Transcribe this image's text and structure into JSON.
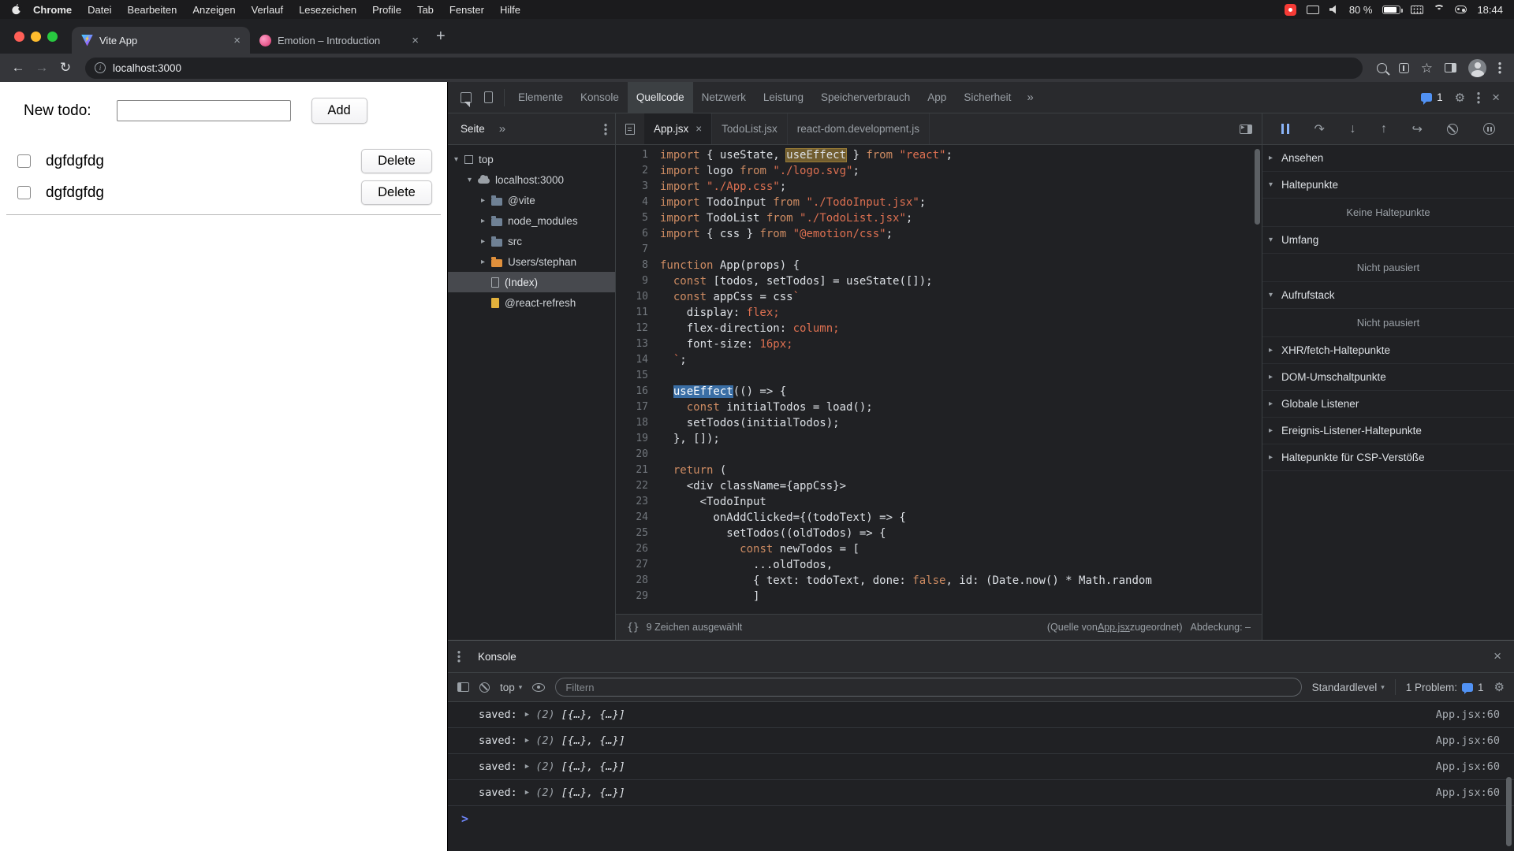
{
  "menubar": {
    "items": [
      "Chrome",
      "Datei",
      "Bearbeiten",
      "Anzeigen",
      "Verlauf",
      "Lesezeichen",
      "Profile",
      "Tab",
      "Fenster",
      "Hilfe"
    ],
    "battery": "80 %",
    "time": "18:44"
  },
  "browser": {
    "tabs": [
      {
        "title": "Vite App",
        "icon": "vite"
      },
      {
        "title": "Emotion – Introduction",
        "icon": "emotion"
      }
    ],
    "url": "localhost:3000",
    "new_tab": "+"
  },
  "page": {
    "new_todo_label": "New todo:",
    "add_button": "Add",
    "delete_button": "Delete",
    "todos": [
      "dgfdgfdg",
      "dgfdgfdg"
    ]
  },
  "devtools": {
    "top_tabs": [
      {
        "label": "Elemente",
        "selected": false
      },
      {
        "label": "Konsole",
        "selected": false
      },
      {
        "label": "Quellcode",
        "selected": true
      },
      {
        "label": "Netzwerk",
        "selected": false
      },
      {
        "label": "Leistung",
        "selected": false
      },
      {
        "label": "Speicherverbrauch",
        "selected": false
      },
      {
        "label": "App",
        "selected": false
      },
      {
        "label": "Sicherheit",
        "selected": false
      }
    ],
    "more_tabs": "»",
    "issues_count": "1",
    "navigator": {
      "tab": "Seite",
      "more": "»",
      "tree": [
        {
          "label": "top",
          "depth": 0,
          "caret": "expanded",
          "icon": "frame",
          "selected": false
        },
        {
          "label": "localhost:3000",
          "depth": 1,
          "caret": "expanded",
          "icon": "cloud",
          "selected": false
        },
        {
          "label": "@vite",
          "depth": 2,
          "caret": "collapsed",
          "icon": "folder",
          "selected": false
        },
        {
          "label": "node_modules",
          "depth": 2,
          "caret": "collapsed",
          "icon": "folder",
          "selected": false
        },
        {
          "label": "src",
          "depth": 2,
          "caret": "collapsed",
          "icon": "folder",
          "selected": false
        },
        {
          "label": "Users/stephan",
          "depth": 2,
          "caret": "collapsed",
          "icon": "folder-orange",
          "selected": false
        },
        {
          "label": "(Index)",
          "depth": 2,
          "caret": "none",
          "icon": "doc",
          "selected": true
        },
        {
          "label": "@react-refresh",
          "depth": 2,
          "caret": "none",
          "icon": "doc-orange",
          "selected": false
        }
      ]
    },
    "editor": {
      "tabs": [
        {
          "label": "App.jsx",
          "selected": true,
          "closable": true
        },
        {
          "label": "TodoList.jsx",
          "selected": false,
          "closable": false
        },
        {
          "label": "react-dom.development.js",
          "selected": false,
          "closable": false
        }
      ],
      "status_left": "9 Zeichen ausgewählt",
      "status_right_pre": "(Quelle von ",
      "status_right_link": "App.jsx",
      "status_right_post": " zugeordnet)",
      "status_coverage": "Abdeckung: –",
      "code": [
        {
          "n": "1",
          "t": [
            [
              "k",
              "import"
            ],
            [
              "p",
              " { useState, "
            ],
            [
              "m",
              "useEffect"
            ],
            [
              "p",
              " } "
            ],
            [
              "k",
              "from"
            ],
            [
              "p",
              " "
            ],
            [
              "s",
              "\"react\""
            ],
            [
              "p",
              ";"
            ]
          ]
        },
        {
          "n": "2",
          "t": [
            [
              "k",
              "import"
            ],
            [
              "p",
              " logo "
            ],
            [
              "k",
              "from"
            ],
            [
              "p",
              " "
            ],
            [
              "s",
              "\"./logo.svg\""
            ],
            [
              "p",
              ";"
            ]
          ]
        },
        {
          "n": "3",
          "t": [
            [
              "k",
              "import"
            ],
            [
              "p",
              " "
            ],
            [
              "s",
              "\"./App.css\""
            ],
            [
              "p",
              ";"
            ]
          ]
        },
        {
          "n": "4",
          "t": [
            [
              "k",
              "import"
            ],
            [
              "p",
              " TodoInput "
            ],
            [
              "k",
              "from"
            ],
            [
              "p",
              " "
            ],
            [
              "s",
              "\"./TodoInput.jsx\""
            ],
            [
              "p",
              ";"
            ]
          ]
        },
        {
          "n": "5",
          "t": [
            [
              "k",
              "import"
            ],
            [
              "p",
              " TodoList "
            ],
            [
              "k",
              "from"
            ],
            [
              "p",
              " "
            ],
            [
              "s",
              "\"./TodoList.jsx\""
            ],
            [
              "p",
              ";"
            ]
          ]
        },
        {
          "n": "6",
          "t": [
            [
              "k",
              "import"
            ],
            [
              "p",
              " { css } "
            ],
            [
              "k",
              "from"
            ],
            [
              "p",
              " "
            ],
            [
              "s",
              "\"@emotion/css\""
            ],
            [
              "p",
              ";"
            ]
          ]
        },
        {
          "n": "7",
          "t": []
        },
        {
          "n": "8",
          "t": [
            [
              "k",
              "function"
            ],
            [
              "p",
              " App(props) {"
            ]
          ]
        },
        {
          "n": "9",
          "t": [
            [
              "p",
              "  "
            ],
            [
              "k",
              "const"
            ],
            [
              "p",
              " [todos, setTodos] = useState([]);"
            ]
          ]
        },
        {
          "n": "10",
          "t": [
            [
              "p",
              "  "
            ],
            [
              "k",
              "const"
            ],
            [
              "p",
              " appCss = css"
            ],
            [
              "s",
              "`"
            ]
          ]
        },
        {
          "n": "11",
          "t": [
            [
              "p",
              "    display: "
            ],
            [
              "s",
              "flex;"
            ]
          ]
        },
        {
          "n": "12",
          "t": [
            [
              "p",
              "    flex-direction: "
            ],
            [
              "s",
              "column;"
            ]
          ]
        },
        {
          "n": "13",
          "t": [
            [
              "p",
              "    font-size: "
            ],
            [
              "s",
              "16px;"
            ]
          ]
        },
        {
          "n": "14",
          "t": [
            [
              "p",
              "  "
            ],
            [
              "s",
              "`"
            ],
            [
              "p",
              ";"
            ]
          ]
        },
        {
          "n": "15",
          "t": []
        },
        {
          "n": "16",
          "t": [
            [
              "p",
              "  "
            ],
            [
              "x",
              "useEffect"
            ],
            [
              "p",
              "(() => {"
            ]
          ]
        },
        {
          "n": "17",
          "t": [
            [
              "p",
              "    "
            ],
            [
              "k",
              "const"
            ],
            [
              "p",
              " initialTodos = load();"
            ]
          ]
        },
        {
          "n": "18",
          "t": [
            [
              "p",
              "    setTodos(initialTodos);"
            ]
          ]
        },
        {
          "n": "19",
          "t": [
            [
              "p",
              "  }, []);"
            ]
          ]
        },
        {
          "n": "20",
          "t": []
        },
        {
          "n": "21",
          "t": [
            [
              "p",
              "  "
            ],
            [
              "k",
              "return"
            ],
            [
              "p",
              " ("
            ]
          ]
        },
        {
          "n": "22",
          "t": [
            [
              "p",
              "    <div className={appCss}>"
            ]
          ]
        },
        {
          "n": "23",
          "t": [
            [
              "p",
              "      <TodoInput"
            ]
          ]
        },
        {
          "n": "24",
          "t": [
            [
              "p",
              "        onAddClicked={(todoText) => {"
            ]
          ]
        },
        {
          "n": "25",
          "t": [
            [
              "p",
              "          setTodos((oldTodos) => {"
            ]
          ]
        },
        {
          "n": "26",
          "t": [
            [
              "p",
              "            "
            ],
            [
              "k",
              "const"
            ],
            [
              "p",
              " newTodos = ["
            ]
          ]
        },
        {
          "n": "27",
          "t": [
            [
              "p",
              "              ...oldTodos,"
            ]
          ]
        },
        {
          "n": "28",
          "t": [
            [
              "p",
              "              { text: todoText, done: "
            ],
            [
              "k",
              "false"
            ],
            [
              "p",
              ", id: (Date.now() * Math.random"
            ]
          ]
        },
        {
          "n": "29",
          "t": [
            [
              "p",
              "              ]"
            ]
          ]
        }
      ]
    },
    "debugger": {
      "sections": [
        {
          "label": "Ansehen",
          "expanded": false,
          "content": ""
        },
        {
          "label": "Haltepunkte",
          "expanded": true,
          "content": "Keine Haltepunkte"
        },
        {
          "label": "Umfang",
          "expanded": true,
          "content": "Nicht pausiert"
        },
        {
          "label": "Aufrufstack",
          "expanded": true,
          "content": "Nicht pausiert"
        },
        {
          "label": "XHR/fetch-Haltepunkte",
          "expanded": false,
          "content": ""
        },
        {
          "label": "DOM-Umschaltpunkte",
          "expanded": false,
          "content": ""
        },
        {
          "label": "Globale Listener",
          "expanded": false,
          "content": ""
        },
        {
          "label": "Ereignis-Listener-Haltepunkte",
          "expanded": false,
          "content": ""
        },
        {
          "label": "Haltepunkte für CSP-Verstöße",
          "expanded": false,
          "content": ""
        }
      ]
    },
    "console": {
      "tab": "Konsole",
      "context": "top",
      "filter_placeholder": "Filtern",
      "level": "Standardlevel",
      "problem_label": "1 Problem:",
      "problem_count": "1",
      "messages": [
        {
          "label": "saved:",
          "count": "(2)",
          "value": "[{…}, {…}]",
          "link": "App.jsx:60"
        },
        {
          "label": "saved:",
          "count": "(2)",
          "value": "[{…}, {…}]",
          "link": "App.jsx:60"
        },
        {
          "label": "saved:",
          "count": "(2)",
          "value": "[{…}, {…}]",
          "link": "App.jsx:60"
        },
        {
          "label": "saved:",
          "count": "(2)",
          "value": "[{…}, {…}]",
          "link": "App.jsx:60"
        }
      ]
    }
  }
}
